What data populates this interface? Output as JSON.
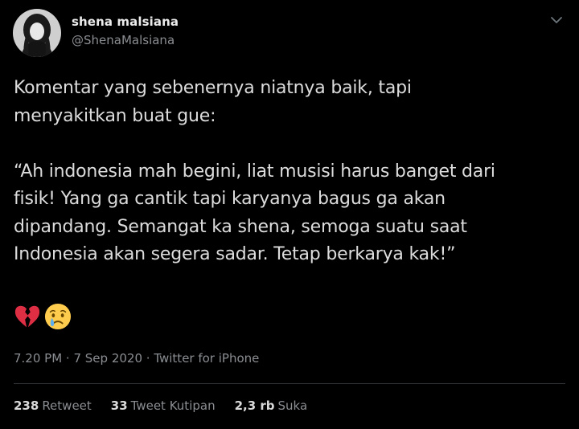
{
  "tweet": {
    "author": {
      "display_name": "shena malsiana",
      "handle": "@ShenaMalsiana"
    },
    "text": "Komentar yang sebenernya niatnya baik, tapi\nmenyakitkan buat gue:\n\n“Ah indonesia mah begini, liat musisi harus banget dari\nfisik! Yang ga cantik tapi karyanya bagus ga akan\ndipandang. Semangat ka shena, semoga suatu saat\nIndonesia akan segera sadar. Tetap berkarya kak!”",
    "emojis": [
      "broken-heart-icon",
      "crying-face-icon"
    ],
    "time": "7.20 PM",
    "separator": " · ",
    "date": "7 Sep 2020",
    "source": "Twitter for iPhone",
    "stats": {
      "retweets": {
        "count": "238",
        "label": "Retweet"
      },
      "quotes": {
        "count": "33",
        "label": "Tweet Kutipan"
      },
      "likes": {
        "count": "2,3 rb",
        "label": "Suka"
      }
    }
  },
  "colors": {
    "background": "#000000",
    "text": "#d9d9d9",
    "secondary": "#8a8d91",
    "divider": "#2f3336"
  }
}
